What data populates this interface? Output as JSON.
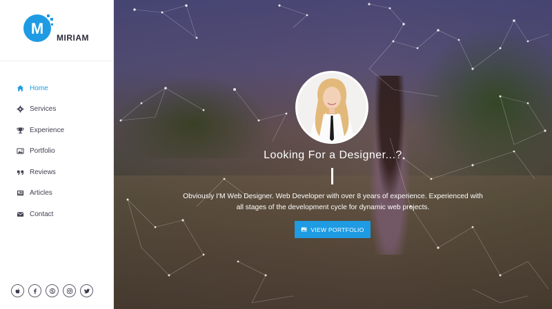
{
  "brand": {
    "name": "MIRIAM",
    "logo_letter": "M",
    "accent": "#1e9be3"
  },
  "nav": [
    {
      "label": "Home",
      "icon": "home-icon",
      "active": true
    },
    {
      "label": "Services",
      "icon": "gear-icon",
      "active": false
    },
    {
      "label": "Experience",
      "icon": "trophy-icon",
      "active": false
    },
    {
      "label": "Portfolio",
      "icon": "image-icon",
      "active": false
    },
    {
      "label": "Reviews",
      "icon": "quote-icon",
      "active": false
    },
    {
      "label": "Articles",
      "icon": "article-icon",
      "active": false
    },
    {
      "label": "Contact",
      "icon": "envelope-icon",
      "active": false
    }
  ],
  "socials": [
    "apple-icon",
    "facebook-icon",
    "skype-icon",
    "instagram-icon",
    "twitter-icon"
  ],
  "hero": {
    "headline": "Looking For a Designer...?",
    "description": "Obviously I'M Web Designer. Web Developer with over 8 years of experience. Experienced with all stages of the development cycle for dynamic web projects.",
    "cta_label": "VIEW PORTFOLIO"
  }
}
